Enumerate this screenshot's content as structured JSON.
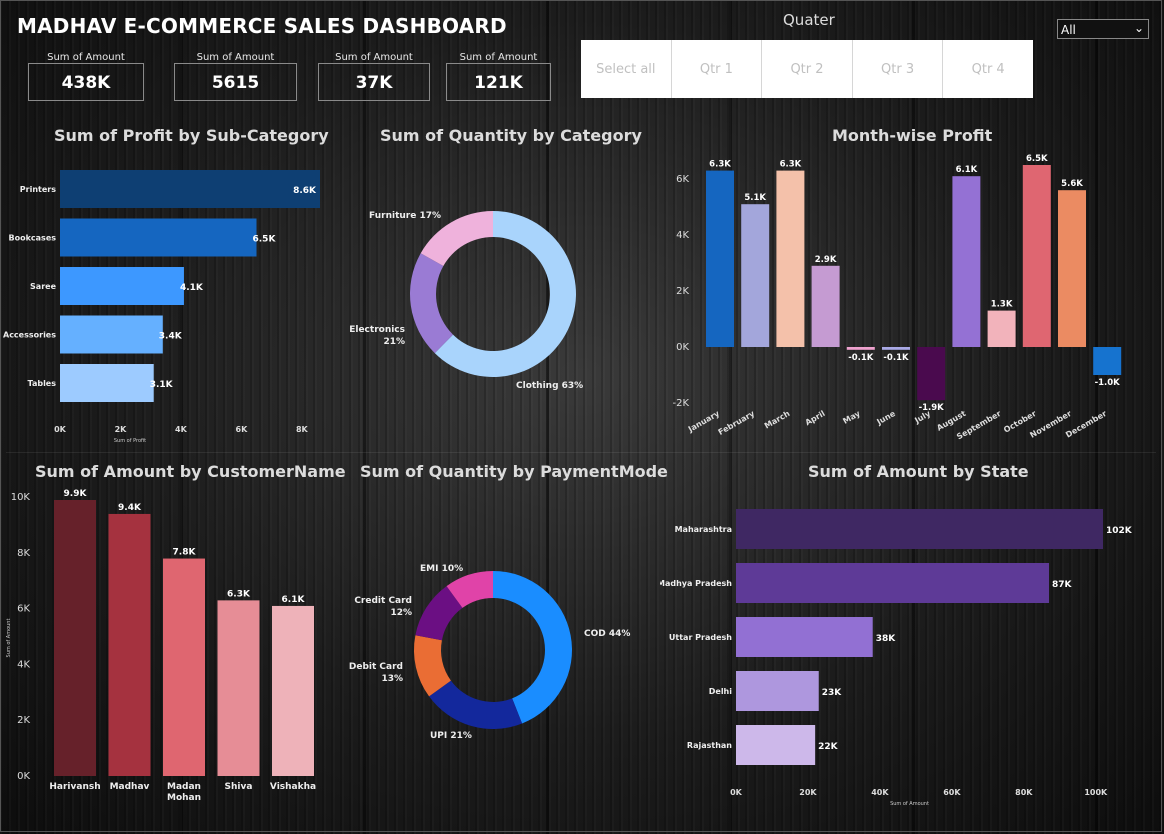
{
  "header": {
    "title": "MADHAV E-COMMERCE SALES DASHBOARD"
  },
  "cards": [
    {
      "label": "Sum of Amount",
      "value": "438K"
    },
    {
      "label": "Sum of Amount",
      "value": "5615"
    },
    {
      "label": "Sum of Amount",
      "value": "37K"
    },
    {
      "label": "Sum of Amount",
      "value": "121K"
    }
  ],
  "slicer": {
    "title": "Quater",
    "options": [
      "Select all",
      "Qtr 1",
      "Qtr 2",
      "Qtr 3",
      "Qtr 4"
    ],
    "dropdown_value": "All"
  },
  "chart_data": [
    {
      "type": "bar",
      "orientation": "horizontal",
      "title": "Sum of Profit by Sub-Category",
      "xlabel": "Sum of Profit",
      "ylabel": "",
      "categories": [
        "Printers",
        "Bookcases",
        "Saree",
        "Accessories",
        "Tables"
      ],
      "values": [
        8600,
        6500,
        4100,
        3400,
        3100
      ],
      "data_labels": [
        "8.6K",
        "6.5K",
        "4.1K",
        "3.4K",
        "3.1K"
      ],
      "colors": [
        "#0e3f73",
        "#1566c0",
        "#3d98ff",
        "#65b0ff",
        "#9dcbff"
      ],
      "xlim": [
        0,
        8600
      ],
      "xticks": [
        0,
        2000,
        4000,
        6000,
        8000
      ],
      "xtick_labels": [
        "0K",
        "2K",
        "4K",
        "6K",
        "8K"
      ]
    },
    {
      "type": "pie",
      "donut": true,
      "title": "Sum of Quantity by Category",
      "categories": [
        "Clothing",
        "Electronics",
        "Furniture"
      ],
      "values": [
        63,
        21,
        17
      ],
      "labels": [
        "Clothing 63%",
        "Electronics 21%",
        "Furniture 17%"
      ],
      "colors": [
        "#a9d4fc",
        "#9a7bd4",
        "#efb2dc"
      ]
    },
    {
      "type": "bar",
      "title": "Month-wise Profit",
      "xlabel": "",
      "ylabel": "",
      "categories": [
        "January",
        "February",
        "March",
        "April",
        "May",
        "June",
        "July",
        "August",
        "September",
        "October",
        "November",
        "December"
      ],
      "values": [
        6300,
        5100,
        6300,
        2900,
        -100,
        -100,
        -1900,
        6100,
        1300,
        6500,
        5600,
        -1000
      ],
      "data_labels": [
        "6.3K",
        "5.1K",
        "6.3K",
        "2.9K",
        "-0.1K",
        "-0.1K",
        "-1.9K",
        "6.1K",
        "1.3K",
        "6.5K",
        "5.6K",
        "-1.0K"
      ],
      "colors": [
        "#1566c0",
        "#a3a6db",
        "#f4c1aa",
        "#c59bd2",
        "#efa2cf",
        "#a9a9e6",
        "#4a0a4e",
        "#9471d4",
        "#f2b3bb",
        "#df6671",
        "#eb8b62",
        "#1673cf"
      ],
      "ylim": [
        -2000,
        6500
      ],
      "yticks": [
        -2000,
        0,
        2000,
        4000,
        6000
      ],
      "ytick_labels": [
        "-2K",
        "0K",
        "2K",
        "4K",
        "6K"
      ]
    },
    {
      "type": "bar",
      "title": "Sum of Amount by CustomerName",
      "xlabel": "",
      "ylabel": "Sum of Amount",
      "categories": [
        "Harivansh",
        "Madhav",
        "Madan Mohan",
        "Shiva",
        "Vishakha"
      ],
      "values": [
        9900,
        9400,
        7800,
        6300,
        6100
      ],
      "data_labels": [
        "9.9K",
        "9.4K",
        "7.8K",
        "6.3K",
        "6.1K"
      ],
      "colors": [
        "#66212a",
        "#a5323f",
        "#df6670",
        "#e68d96",
        "#eeb2b9"
      ],
      "ylim": [
        0,
        9900
      ],
      "yticks": [
        0,
        2000,
        4000,
        6000,
        8000,
        10000
      ],
      "ytick_labels": [
        "0K",
        "2K",
        "4K",
        "6K",
        "8K",
        "10K"
      ]
    },
    {
      "type": "pie",
      "donut": true,
      "title": "Sum of Quantity by PaymentMode",
      "categories": [
        "COD",
        "UPI",
        "Debit Card",
        "Credit Card",
        "EMI"
      ],
      "values": [
        44,
        21,
        13,
        12,
        10
      ],
      "labels": [
        "COD 44%",
        "UPI 21%",
        "Debit Card 13%",
        "Credit Card 12%",
        "EMI 10%"
      ],
      "colors": [
        "#1a8dff",
        "#13289c",
        "#ea6d34",
        "#6b0f83",
        "#e043a8"
      ]
    },
    {
      "type": "bar",
      "orientation": "horizontal",
      "title": "Sum of Amount by State",
      "xlabel": "Sum of Amount",
      "ylabel": "",
      "categories": [
        "Maharashtra",
        "Madhya Pradesh",
        "Uttar Pradesh",
        "Delhi",
        "Rajasthan"
      ],
      "values": [
        102000,
        87000,
        38000,
        23000,
        22000
      ],
      "data_labels": [
        "102K",
        "87K",
        "38K",
        "23K",
        "22K"
      ],
      "colors": [
        "#3f2863",
        "#5e3a97",
        "#9270d3",
        "#ae97de",
        "#cdb8ea"
      ],
      "xlim": [
        0,
        102000
      ],
      "xticks": [
        0,
        20000,
        40000,
        60000,
        80000,
        100000
      ],
      "xtick_labels": [
        "0K",
        "20K",
        "40K",
        "60K",
        "80K",
        "100K"
      ]
    }
  ]
}
